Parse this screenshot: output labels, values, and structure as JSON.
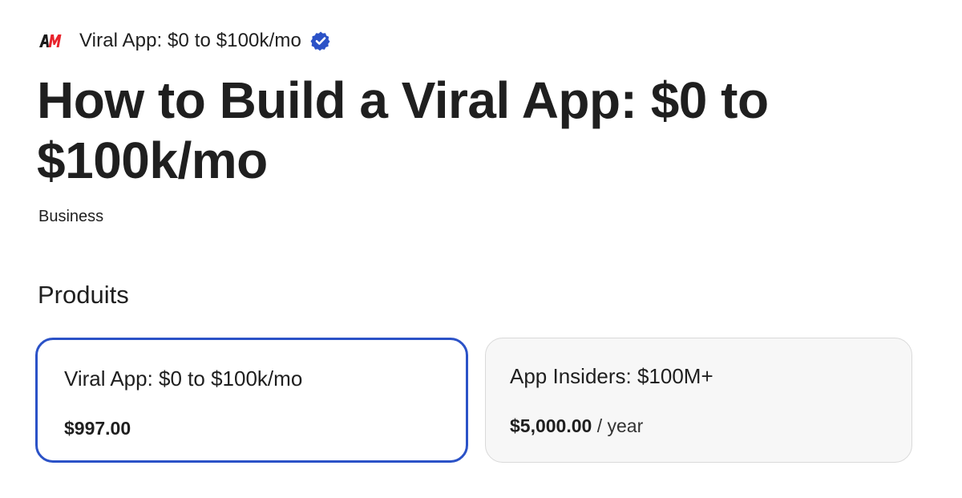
{
  "store": {
    "logo_text": "AM",
    "name": "Viral App: $0 to $100k/mo",
    "verified_icon": "verified-badge-icon"
  },
  "page": {
    "title": "How to Build a Viral App: $0 to $100k/mo",
    "category": "Business"
  },
  "products": {
    "heading": "Produits",
    "items": [
      {
        "name": "Viral App: $0 to $100k/mo",
        "price": "$997.00",
        "period": "",
        "selected": true
      },
      {
        "name": "App Insiders: $100M+",
        "price": "$5,000.00",
        "period": "/ year",
        "selected": false
      }
    ]
  },
  "colors": {
    "accent": "#2b52c7",
    "logo_red": "#e8232c",
    "logo_dark": "#1a1a1a",
    "text": "#1f1f1f",
    "card_bg": "#f7f7f7",
    "card_border": "#d9d9d9"
  }
}
